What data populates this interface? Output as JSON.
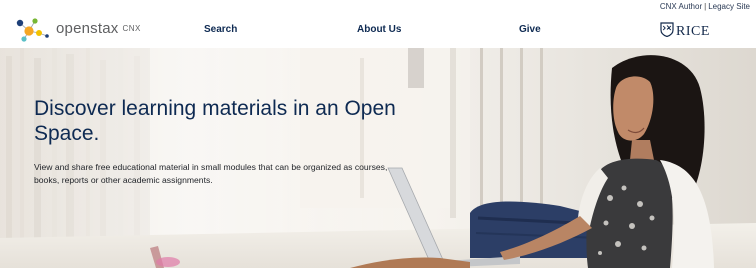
{
  "utility": {
    "cnx_author": "CNX Author",
    "separator": "|",
    "legacy_site": "Legacy Site"
  },
  "brand": {
    "name": "openstax",
    "product": "CNX",
    "icon": "openstax-dots-icon"
  },
  "nav": {
    "search": "Search",
    "about": "About Us",
    "give": "Give"
  },
  "partner": {
    "name": "RICE",
    "icon": "rice-shield-icon"
  },
  "hero": {
    "title": "Discover learning materials in an Open Space.",
    "body": "View and share free educational material in small modules that can be organized as courses, books, reports or other academic assignments."
  },
  "colors": {
    "nav_text": "#0e2a52",
    "logo_text": "#5f6062",
    "dot_blue": "#1e3f78",
    "dot_orange": "#f5a623",
    "dot_green": "#77b633",
    "dot_teal": "#5bbfc6",
    "dot_yellow": "#f2c200"
  }
}
